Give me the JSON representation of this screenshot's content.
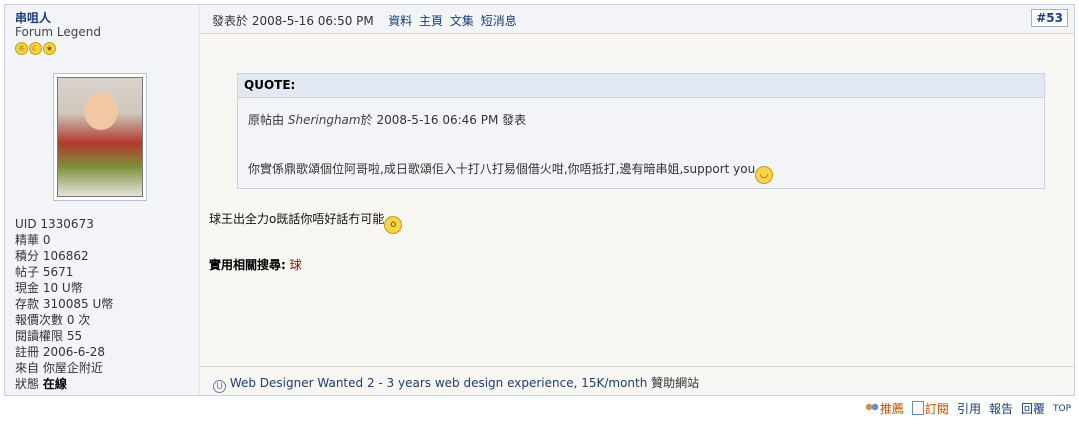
{
  "user": {
    "name": "串咀人",
    "title": "Forum Legend",
    "stats": [
      {
        "label": "UID",
        "value": "1330673"
      },
      {
        "label": "精華",
        "value": "0"
      },
      {
        "label": "積分",
        "value": "106862"
      },
      {
        "label": "帖子",
        "value": "5671"
      },
      {
        "label": "現金",
        "value": "10 U幣"
      },
      {
        "label": "存款",
        "value": "310085 U幣"
      },
      {
        "label": "報價次數",
        "value": "0 次"
      },
      {
        "label": "閱讀權限",
        "value": "55"
      },
      {
        "label": "註冊",
        "value": "2006-6-28"
      },
      {
        "label": "來自",
        "value": "你屋企附近"
      },
      {
        "label": "狀態",
        "value": "在線"
      }
    ]
  },
  "post": {
    "posted_prefix": "發表於",
    "posted_at": "2008-5-16 06:50 PM",
    "links": [
      "資料",
      "主頁",
      "文集",
      "短消息"
    ],
    "floor": "#53",
    "quote": {
      "title": "QUOTE:",
      "origin_prefix": "原帖由",
      "origin_user": "Sheringham",
      "origin_mid": "於",
      "origin_time": "2008-5-16 06:46 PM",
      "origin_suffix": "發表",
      "text": "你實係鼎歌頌個位阿哥啦,成日歌頌佢入十打八打易個借火咁,你唔抵打,邊有暗串姐,support you"
    },
    "message": "球王出全力o既話你唔好話冇可能",
    "related_label": "實用相關搜尋:",
    "related_keyword": "球"
  },
  "ad": {
    "icon": "U",
    "link": "Web Designer Wanted 2 - 3 years web design experience, 15K/month",
    "suffix": "贊助網站"
  },
  "actions": {
    "recommend": "推薦",
    "subscribe": "訂閱",
    "quote": "引用",
    "report": "報告",
    "reply": "回覆",
    "top": "TOP"
  }
}
